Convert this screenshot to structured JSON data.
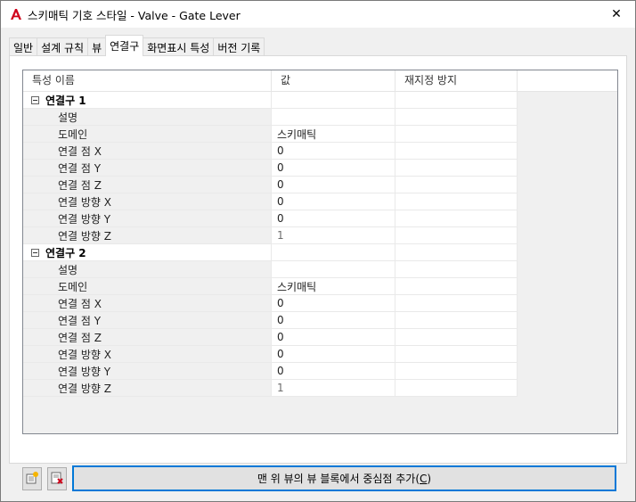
{
  "window": {
    "title": "스키매틱 기호 스타일 - Valve - Gate Lever",
    "close_glyph": "✕"
  },
  "tabs": [
    {
      "label": "일반",
      "active": false
    },
    {
      "label": "설계 규칙",
      "active": false
    },
    {
      "label": "뷰",
      "active": false
    },
    {
      "label": "연결구",
      "active": true
    },
    {
      "label": "화면표시 특성",
      "active": false
    },
    {
      "label": "버전 기록",
      "active": false
    }
  ],
  "grid": {
    "headers": [
      "특성 이름",
      "값",
      "재지정 방지"
    ],
    "groups": [
      {
        "name": "연결구 1",
        "rows": [
          {
            "name": "설명",
            "value": "",
            "disabled": false
          },
          {
            "name": "도메인",
            "value": "스키매틱",
            "disabled": false
          },
          {
            "name": "연결 점 X",
            "value": "0",
            "disabled": false
          },
          {
            "name": "연결 점 Y",
            "value": "0",
            "disabled": false
          },
          {
            "name": "연결 점 Z",
            "value": "0",
            "disabled": false
          },
          {
            "name": "연결 방향 X",
            "value": "0",
            "disabled": false
          },
          {
            "name": "연결 방향 Y",
            "value": "0",
            "disabled": false
          },
          {
            "name": "연결 방향 Z",
            "value": "1",
            "disabled": true
          }
        ]
      },
      {
        "name": "연결구 2",
        "rows": [
          {
            "name": "설명",
            "value": "",
            "disabled": false
          },
          {
            "name": "도메인",
            "value": "스키매틱",
            "disabled": false
          },
          {
            "name": "연결 점 X",
            "value": "0",
            "disabled": false
          },
          {
            "name": "연결 점 Y",
            "value": "0",
            "disabled": false
          },
          {
            "name": "연결 점 Z",
            "value": "0",
            "disabled": false
          },
          {
            "name": "연결 방향 X",
            "value": "0",
            "disabled": false
          },
          {
            "name": "연결 방향 Y",
            "value": "0",
            "disabled": false
          },
          {
            "name": "연결 방향 Z",
            "value": "1",
            "disabled": true
          }
        ]
      }
    ]
  },
  "buttons": {
    "add_connector_icon": "add-connector-icon",
    "delete_connector_icon": "delete-connector-icon",
    "center_button_label": "맨 위 뷰의 뷰 블록에서 중심점 추가(",
    "center_button_mnemonic": "C",
    "center_button_suffix": ")"
  },
  "colors": {
    "accent": "#0078d7",
    "app_icon_red": "#d0021b"
  }
}
